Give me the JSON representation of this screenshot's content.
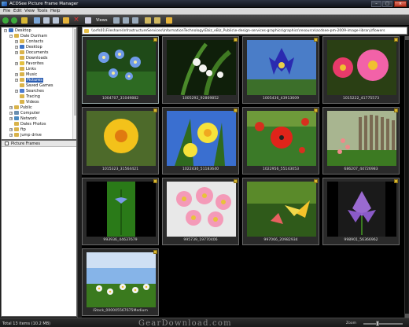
{
  "window": {
    "title": "ACDSee Picture Frame Manager"
  },
  "menu": [
    "File",
    "Edit",
    "View",
    "Tools",
    "Help"
  ],
  "toolbar": {
    "views_label": "Views"
  },
  "address": {
    "path": "\\\\orfs01\\Fileshare\\InfrastructureServices\\InformationTechnology\\Ebiz_eBiz_Public\\e-design-services-graphics\\graphics\\resource\\acdsee-pm-2009-image-library\\flowers"
  },
  "tree": [
    {
      "label": "Desktop",
      "depth": 0,
      "exp": "-",
      "color": "#3a72c8"
    },
    {
      "label": "Dale Dunham",
      "depth": 1,
      "exp": "-",
      "color": "#d9b34a"
    },
    {
      "label": "Contacts",
      "depth": 2,
      "exp": "+",
      "color": "#d9b34a"
    },
    {
      "label": "Desktop",
      "depth": 2,
      "exp": "+",
      "color": "#3a72c8"
    },
    {
      "label": "Documents",
      "depth": 2,
      "exp": "+",
      "color": "#d9b34a"
    },
    {
      "label": "Downloads",
      "depth": 2,
      "exp": "",
      "color": "#d9b34a"
    },
    {
      "label": "Favorites",
      "depth": 2,
      "exp": "+",
      "color": "#e3c040"
    },
    {
      "label": "Links",
      "depth": 2,
      "exp": "",
      "color": "#d9b34a"
    },
    {
      "label": "Music",
      "depth": 2,
      "exp": "+",
      "color": "#d9b34a"
    },
    {
      "label": "Pictures",
      "depth": 2,
      "exp": "+",
      "color": "#d9b34a",
      "selected": true
    },
    {
      "label": "Saved Games",
      "depth": 2,
      "exp": "",
      "color": "#d9b34a"
    },
    {
      "label": "Searches",
      "depth": 2,
      "exp": "+",
      "color": "#4a7ad0"
    },
    {
      "label": "Tracing",
      "depth": 2,
      "exp": "",
      "color": "#d9b34a"
    },
    {
      "label": "Videos",
      "depth": 2,
      "exp": "",
      "color": "#d9b34a"
    },
    {
      "label": "Public",
      "depth": 1,
      "exp": "+",
      "color": "#d9b34a"
    },
    {
      "label": "Computer",
      "depth": 1,
      "exp": "+",
      "color": "#6a8fb0"
    },
    {
      "label": "Network",
      "depth": 1,
      "exp": "+",
      "color": "#4a8ac0"
    },
    {
      "label": "Dales Photos",
      "depth": 1,
      "exp": "",
      "color": "#d9b34a"
    },
    {
      "label": "ftp",
      "depth": 1,
      "exp": "+",
      "color": "#d9b34a"
    },
    {
      "label": "jump drive",
      "depth": 1,
      "exp": "+",
      "color": "#d9b34a"
    }
  ],
  "picture_frames": {
    "label": "Picture Frames"
  },
  "thumbnails": [
    {
      "caption": "1004707_31049882",
      "scene": "blue"
    },
    {
      "caption": "1005292_92869852",
      "scene": "white"
    },
    {
      "caption": "1005436_43913609",
      "scene": "purple"
    },
    {
      "caption": "1015222_41775573",
      "scene": "pink"
    },
    {
      "caption": "1015323_31564421",
      "scene": "yellow"
    },
    {
      "caption": "1022430_51183640",
      "scene": "daffodil"
    },
    {
      "caption": "1022956_55143053",
      "scene": "poppy"
    },
    {
      "caption": "686207_44726983",
      "scene": "fence"
    },
    {
      "caption": "993936_44637679",
      "scene": "bluebell"
    },
    {
      "caption": "995739_19770406",
      "scene": "daisies"
    },
    {
      "caption": "997066_20982934",
      "scene": "lily"
    },
    {
      "caption": "998901_56366962",
      "scene": "crocus"
    },
    {
      "caption": "iStock_000005567675Medium",
      "scene": "meadow"
    }
  ],
  "status": {
    "text": "Total 13 items (10.2 MB)",
    "zoom_label": "Zoom",
    "watermark": "GearDownload.com"
  },
  "colors": {
    "accent": "#2d5fb3",
    "background": "#000000"
  }
}
